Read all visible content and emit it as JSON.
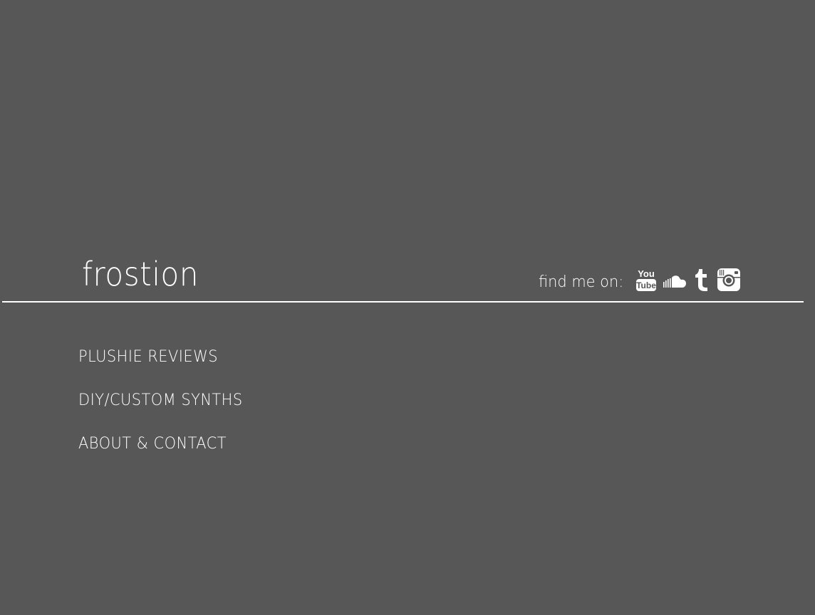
{
  "header": {
    "site_title": "frostion",
    "social_label": "find me on:",
    "social_icons": [
      "youtube-icon",
      "soundcloud-icon",
      "tumblr-icon",
      "instagram-icon"
    ]
  },
  "nav": {
    "items": [
      {
        "label": "PLUSHIE REVIEWS"
      },
      {
        "label": "DIY/CUSTOM SYNTHS"
      },
      {
        "label": "ABOUT & CONTACT"
      }
    ]
  },
  "colors": {
    "background": "#575757",
    "text": "#ffffff"
  }
}
